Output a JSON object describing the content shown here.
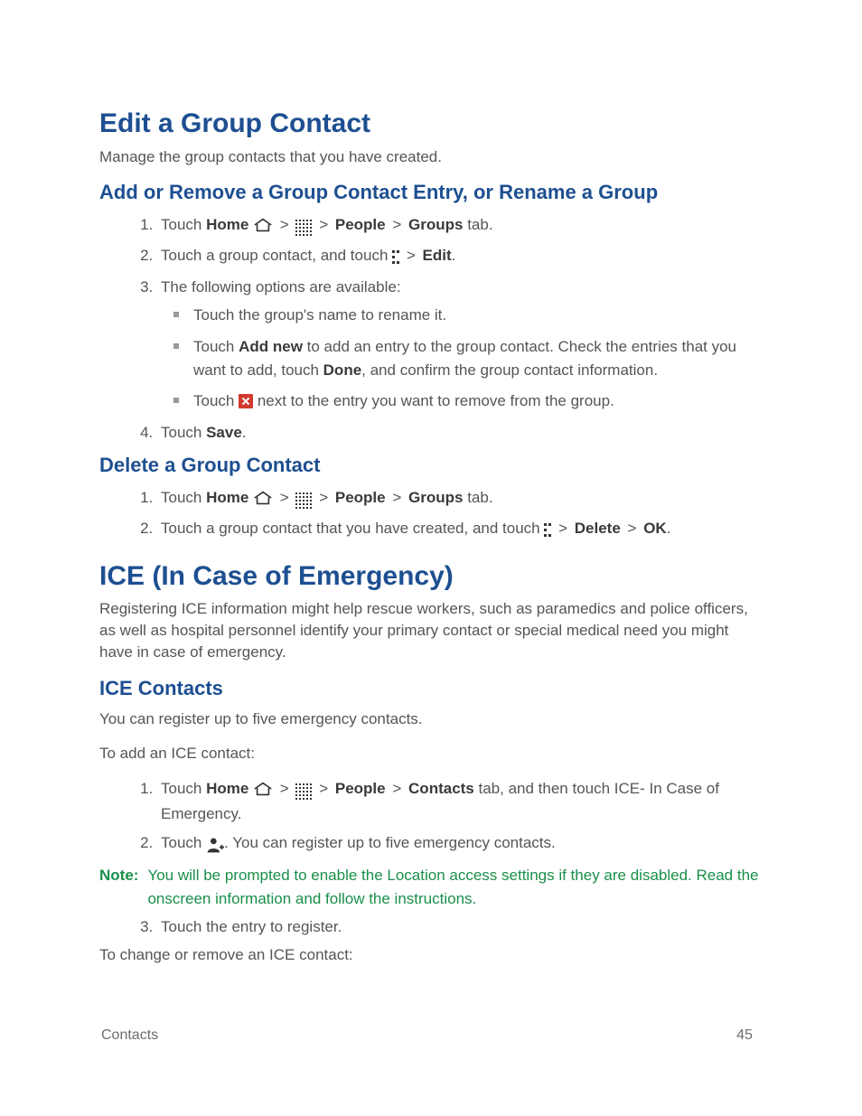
{
  "h1_edit": "Edit a Group Contact",
  "p_edit_intro": "Manage the group contacts that you have created.",
  "h2_addremove": "Add or Remove a Group Contact Entry, or Rename a Group",
  "ar_s1_a": "Touch ",
  "ar_s1_home": "Home",
  "ar_s1_people": "People",
  "ar_s1_groups": "Groups",
  "ar_s1_tab": " tab.",
  "ar_s2_a": "Touch a group contact, and touch ",
  "ar_s2_edit": "Edit",
  "ar_s3": "The following options are available:",
  "ar_b1": "Touch the group's name to rename it.",
  "ar_b2_a": "Touch ",
  "ar_b2_addnew": "Add new",
  "ar_b2_b": " to add an entry to the group contact. Check the entries that you want to add, touch ",
  "ar_b2_done": "Done",
  "ar_b2_c": ", and confirm the group contact information.",
  "ar_b3_a": "Touch ",
  "ar_b3_b": " next to the entry you want to remove from the group.",
  "ar_s4_a": "Touch ",
  "ar_s4_save": "Save",
  "h2_delete": "Delete a Group Contact",
  "dl_s1_a": "Touch ",
  "dl_s1_home": "Home",
  "dl_s1_people": "People",
  "dl_s1_groups": "Groups",
  "dl_s1_tab": " tab.",
  "dl_s2_a": "Touch a group contact that you have created, and touch ",
  "dl_s2_delete": "Delete",
  "dl_s2_ok": "OK",
  "h1_ice": "ICE (In Case of Emergency)",
  "p_ice_intro": "Registering ICE information might help rescue workers, such as paramedics and police officers, as well as hospital personnel identify your primary contact or special medical need you might have in case of emergency.",
  "h2_icecontacts": "ICE Contacts",
  "p_ice_limit": "You can register up to five emergency contacts.",
  "p_ice_add": "To add an ICE contact:",
  "ic_s1_a": "Touch ",
  "ic_s1_home": "Home",
  "ic_s1_people": "People",
  "ic_s1_contacts": "Contacts",
  "ic_s1_b": " tab, and then touch ICE- In Case of Emergency.",
  "ic_s2_a": "Touch ",
  "ic_s2_b": ". You can register up to five emergency contacts.",
  "note_label": "Note:",
  "note_text": "You will be prompted to enable the Location access settings if they are disabled. Read the onscreen information and follow the instructions.",
  "ic_s3": "Touch the entry to register.",
  "p_ice_change": "To change or remove an ICE contact:",
  "footer_section": "Contacts",
  "footer_page": "45",
  "sep_gt": ">",
  "period": "."
}
